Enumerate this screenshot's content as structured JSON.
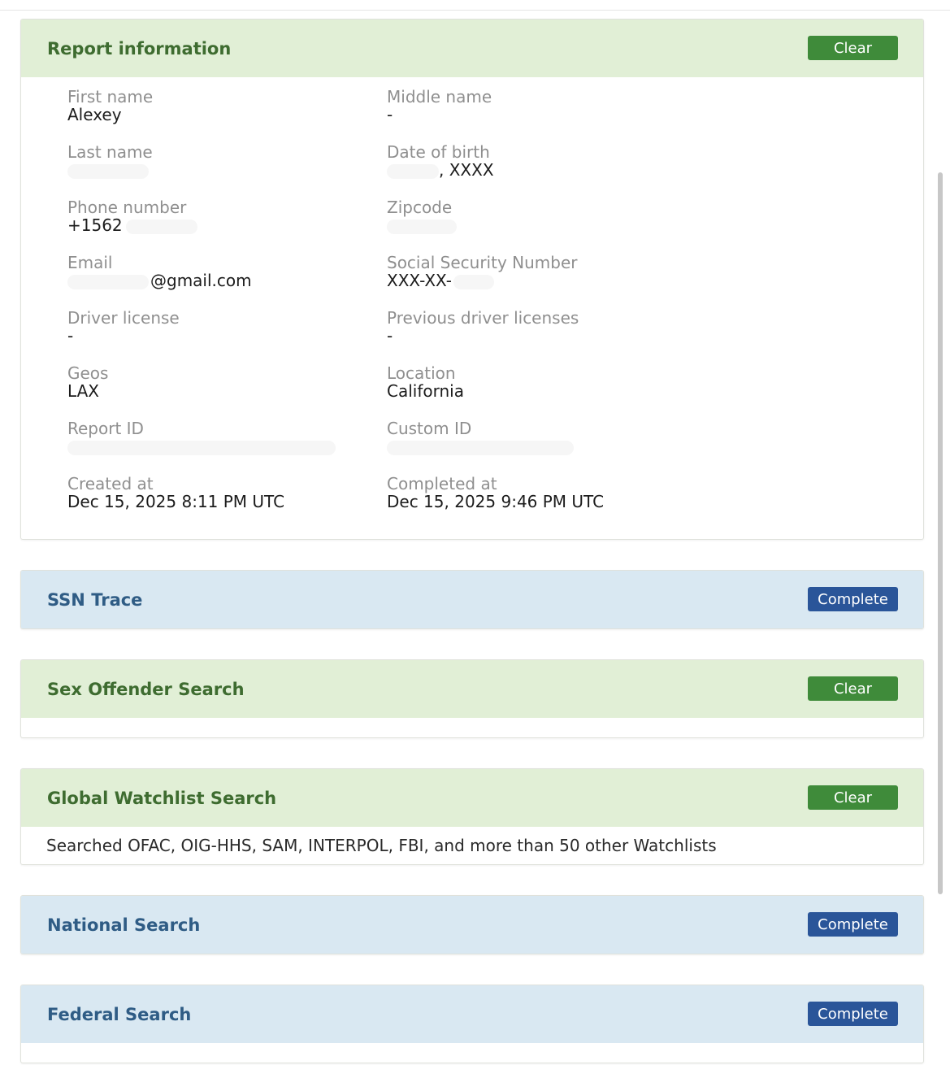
{
  "report_info": {
    "title": "Report information",
    "status": "Clear",
    "fields": {
      "first_name": {
        "label": "First name",
        "value": "Alexey"
      },
      "middle_name": {
        "label": "Middle name",
        "value": "-"
      },
      "last_name": {
        "label": "Last name",
        "value": ""
      },
      "dob": {
        "label": "Date of birth",
        "value": ", XXXX"
      },
      "phone": {
        "label": "Phone number",
        "value": "+1562"
      },
      "zipcode": {
        "label": "Zipcode",
        "value": ""
      },
      "email": {
        "label": "Email",
        "value": "@gmail.com"
      },
      "ssn": {
        "label": "Social Security Number",
        "value": "XXX-XX-"
      },
      "driver_license": {
        "label": "Driver license",
        "value": "-"
      },
      "prev_driver_licenses": {
        "label": "Previous driver licenses",
        "value": "-"
      },
      "geos": {
        "label": "Geos",
        "value": "LAX"
      },
      "location": {
        "label": "Location",
        "value": "California"
      },
      "report_id": {
        "label": "Report ID",
        "value": ""
      },
      "custom_id": {
        "label": "Custom ID",
        "value": ""
      },
      "created_at": {
        "label": "Created at",
        "value": "Dec 15, 2025 8:11 PM UTC"
      },
      "completed_at": {
        "label": "Completed at",
        "value": "Dec 15, 2025 9:46 PM UTC"
      }
    }
  },
  "sections": {
    "ssn_trace": {
      "title": "SSN Trace",
      "status": "Complete"
    },
    "sex_offender": {
      "title": "Sex Offender Search",
      "status": "Clear"
    },
    "global_watchlist": {
      "title": "Global Watchlist Search",
      "status": "Clear",
      "body": "Searched OFAC, OIG-HHS, SAM, INTERPOL, FBI, and more than 50 other Watchlists"
    },
    "national": {
      "title": "National Search",
      "status": "Complete"
    },
    "federal": {
      "title": "Federal Search",
      "status": "Complete"
    }
  },
  "colors": {
    "clear_badge": "#3f8b3a",
    "complete_badge": "#2a5599",
    "green_header": "#e1efd6",
    "blue_header": "#d9e8f2"
  }
}
